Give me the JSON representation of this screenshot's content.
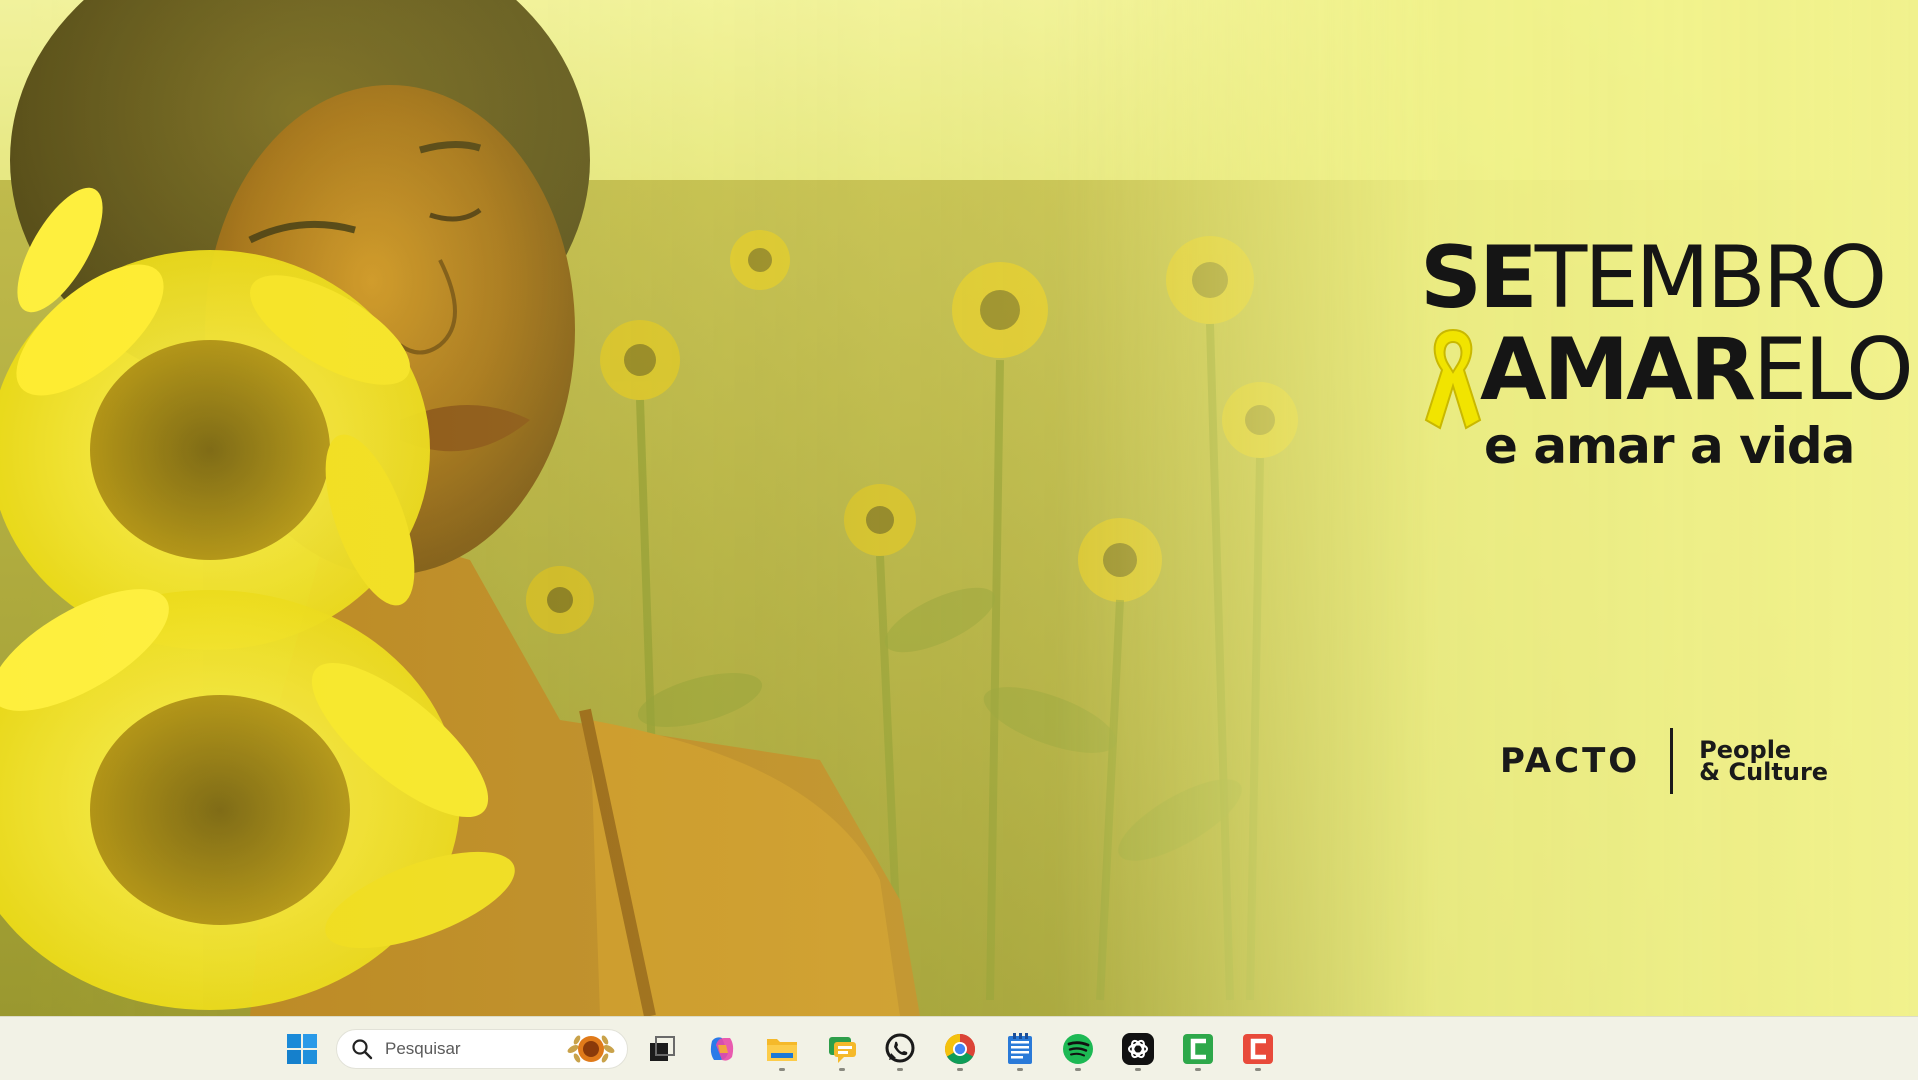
{
  "wallpaper": {
    "headline": {
      "se": "SE",
      "tembro": "TEMBRO",
      "amar": "AMAR",
      "elo": "ELO",
      "tagline": "e amar a vida"
    },
    "brand": {
      "name": "PACTO",
      "division_line1": "People",
      "division_line2": "& Culture"
    },
    "accent_color": "#f1e400"
  },
  "taskbar": {
    "search": {
      "placeholder": "Pesquisar"
    },
    "apps": [
      {
        "name": "task-view",
        "icon": "task-view-icon",
        "running": false
      },
      {
        "name": "copilot",
        "icon": "copilot-icon",
        "running": false
      },
      {
        "name": "file-explorer",
        "icon": "folder-icon",
        "running": true
      },
      {
        "name": "teams",
        "icon": "chat-icon",
        "running": true
      },
      {
        "name": "whatsapp",
        "icon": "whatsapp-icon",
        "running": true
      },
      {
        "name": "chrome",
        "icon": "chrome-icon",
        "running": true
      },
      {
        "name": "notepad",
        "icon": "notepad-icon",
        "running": true
      },
      {
        "name": "spotify",
        "icon": "spotify-icon",
        "running": true
      },
      {
        "name": "chatgpt",
        "icon": "chatgpt-icon",
        "running": true
      },
      {
        "name": "app-green",
        "icon": "green-c-icon",
        "running": true
      },
      {
        "name": "app-red",
        "icon": "red-c-icon",
        "running": true
      }
    ]
  }
}
